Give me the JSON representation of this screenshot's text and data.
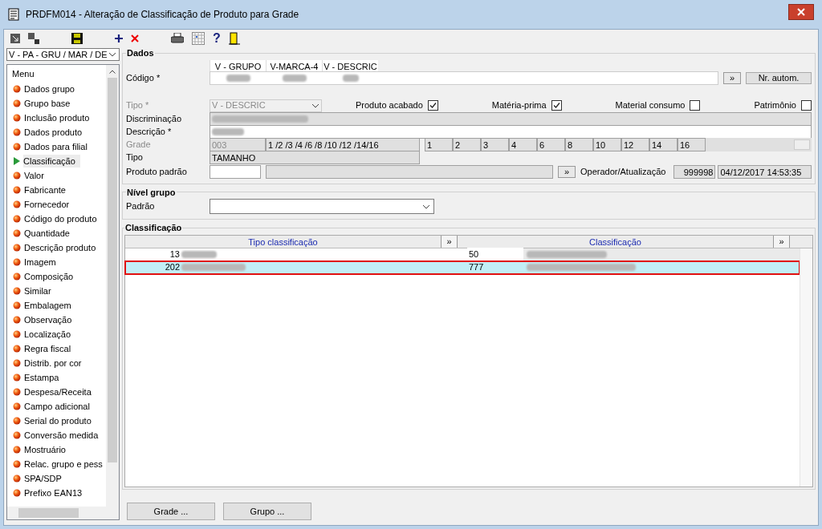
{
  "window": {
    "title": "PRDFM014 - Alteração de Classificação de Produto para Grade"
  },
  "toolbar": {
    "help": "?"
  },
  "sidebar": {
    "selector": "V - PA - GRU / MAR / DE",
    "menu_title": "Menu",
    "items": [
      {
        "label": "Dados grupo",
        "selected": false
      },
      {
        "label": "Grupo base",
        "selected": false
      },
      {
        "label": "Inclusão produto",
        "selected": false
      },
      {
        "label": "Dados produto",
        "selected": false
      },
      {
        "label": "Dados para filial",
        "selected": false
      },
      {
        "label": "Classificação",
        "selected": true
      },
      {
        "label": "Valor",
        "selected": false
      },
      {
        "label": "Fabricante",
        "selected": false
      },
      {
        "label": "Fornecedor",
        "selected": false
      },
      {
        "label": "Código do produto",
        "selected": false
      },
      {
        "label": "Quantidade",
        "selected": false
      },
      {
        "label": "Descrição produto",
        "selected": false
      },
      {
        "label": "Imagem",
        "selected": false
      },
      {
        "label": "Composição",
        "selected": false
      },
      {
        "label": "Similar",
        "selected": false
      },
      {
        "label": "Embalagem",
        "selected": false
      },
      {
        "label": "Observação",
        "selected": false
      },
      {
        "label": "Localização",
        "selected": false
      },
      {
        "label": "Regra fiscal",
        "selected": false
      },
      {
        "label": "Distrib. por cor",
        "selected": false
      },
      {
        "label": "Estampa",
        "selected": false
      },
      {
        "label": "Despesa/Receita",
        "selected": false
      },
      {
        "label": "Campo adicional",
        "selected": false
      },
      {
        "label": "Serial do produto",
        "selected": false
      },
      {
        "label": "Conversão medida",
        "selected": false
      },
      {
        "label": "Mostruário",
        "selected": false
      },
      {
        "label": "Relac. grupo e pess",
        "selected": false
      },
      {
        "label": "SPA/SDP",
        "selected": false
      },
      {
        "label": "Prefixo EAN13",
        "selected": false
      }
    ]
  },
  "dados": {
    "title": "Dados",
    "codigo_label": "Código *",
    "codigo_columns": [
      "V - GRUPO",
      "V-MARCA-4",
      "V - DESCRIC"
    ],
    "more_button": "»",
    "auto_button": "Nr. autom.",
    "tipo": {
      "label": "Tipo *",
      "value": "V - DESCRIC",
      "disabled": true
    },
    "checks": [
      {
        "label": "Produto acabado",
        "checked": true
      },
      {
        "label": "Matéria-prima",
        "checked": true
      },
      {
        "label": "Material consumo",
        "checked": false
      },
      {
        "label": "Patrimônio",
        "checked": false
      }
    ],
    "discriminacao_label": "Discriminação",
    "descricao_label": "Descrição *",
    "grade": {
      "label": "Grade",
      "disabled": true,
      "code": "003",
      "sizes_text": "1 /2 /3 /4 /6 /8 /10 /12 /14/16",
      "sizes": [
        "1",
        "2",
        "3",
        "4",
        "6",
        "8",
        "10",
        "12",
        "14",
        "16"
      ]
    },
    "tipo2": {
      "label": "Tipo",
      "value": "TAMANHO"
    },
    "produto_padrao_label": "Produto padrão",
    "produto_more_button": "»",
    "operador_label": "Operador/Atualização",
    "operador": "999998",
    "atualizacao": "04/12/2017 14:53:35"
  },
  "nivel_grupo": {
    "title": "Nível grupo",
    "padrao_label": "Padrão"
  },
  "classificacao": {
    "title": "Classificação",
    "columns": [
      "Tipo classificação",
      "Classificação"
    ],
    "column_button": "»",
    "rows": [
      {
        "tipo": "13",
        "classificacao": "50",
        "selected": false
      },
      {
        "tipo": "202",
        "classificacao": "777",
        "selected": true
      }
    ]
  },
  "buttons": [
    "Grade ...",
    "Grupo ..."
  ]
}
